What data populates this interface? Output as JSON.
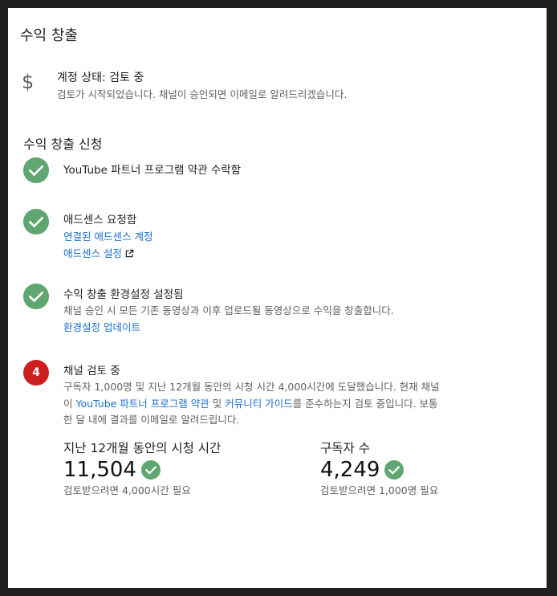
{
  "page": {
    "title": "수익 창출"
  },
  "account_status": {
    "icon": "dollar-icon",
    "title": "계정 상태: 검토 중",
    "description": "검토가 시작되었습니다. 채널이 승인되면 이메일로 알려드리겠습니다."
  },
  "application": {
    "title": "수익 창출 신청",
    "steps": [
      {
        "title": "YouTube 파트너 프로그램 약관 수락함"
      },
      {
        "title": "애드센스 요청함",
        "link1": "연결된 애드센스 계정",
        "link2": "애드센스 설정"
      },
      {
        "title": "수익 창출 환경설정 설정됨",
        "description": "채널 승인 시 모든 기존 동영상과 이후 업로드될 동영상으로 수익을 창출합니다.",
        "link": "환경설정 업데이트"
      },
      {
        "number": "4",
        "title": "채널 검토 중",
        "text_before": "구독자 1,000명 및 지난 12개월 동안의 시청 시간 4,000시간에 도달했습니다. 현재 채널이 ",
        "link_partner": "YouTube 파트너 프로그램 약관",
        "text_mid": " 및 ",
        "link_guidelines": "커뮤니티 가이드",
        "text_after": "를 준수하는지 검토 중입니다. 보통 한 달 내에 결과를 이메일로 알려드립니다."
      }
    ]
  },
  "metrics": {
    "watch_hours": {
      "label": "지난 12개월 동안의 시청 시간",
      "value": "11,504",
      "note": "검토받으려면 4,000시간 필요"
    },
    "subscribers": {
      "label": "구독자 수",
      "value": "4,249",
      "note": "검토받으려면 1,000명 필요"
    }
  },
  "colors": {
    "check_green": "#5fa671",
    "badge_red": "#cc1f1f",
    "link_blue": "#1a6ec9"
  }
}
